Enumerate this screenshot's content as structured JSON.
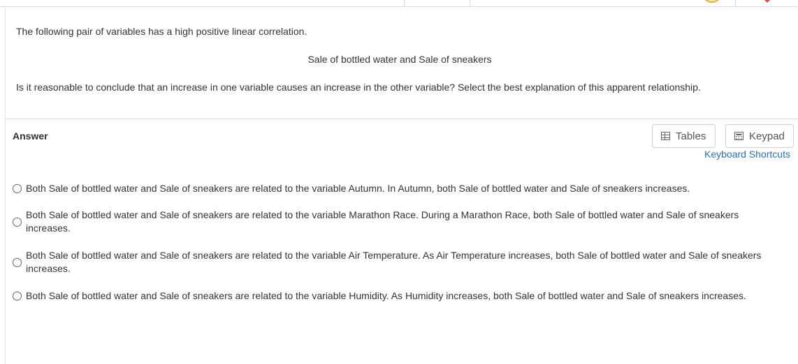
{
  "question": {
    "line1": "The following pair of variables has a high positive linear correlation.",
    "pair": "Sale of bottled water and Sale of sneakers",
    "line3": "Is it reasonable to conclude that an increase in one variable causes an increase in the other variable? Select the best explanation of this apparent relationship."
  },
  "answer": {
    "label": "Answer",
    "tables_label": "Tables",
    "keypad_label": "Keypad",
    "keyboard_shortcuts": "Keyboard Shortcuts",
    "options": [
      {
        "text": "Both Sale of bottled water and Sale of sneakers are related to the variable Autumn. In Autumn, both Sale of bottled water and Sale of sneakers increases."
      },
      {
        "text": "Both Sale of bottled water and Sale of sneakers are related to the variable Marathon Race. During a Marathon Race, both Sale of bottled water and Sale of sneakers increases."
      },
      {
        "text": "Both Sale of bottled water and Sale of sneakers are related to the variable Air Temperature. As Air Temperature increases, both Sale of bottled water and Sale of sneakers increases."
      },
      {
        "text": "Both Sale of bottled water and Sale of sneakers are related to the variable Humidity. As Humidity increases, both Sale of bottled water and Sale of sneakers increases."
      }
    ]
  },
  "colors": {
    "link": "#2a6ebb",
    "text": "#333333",
    "border": "#dcdcdc"
  }
}
